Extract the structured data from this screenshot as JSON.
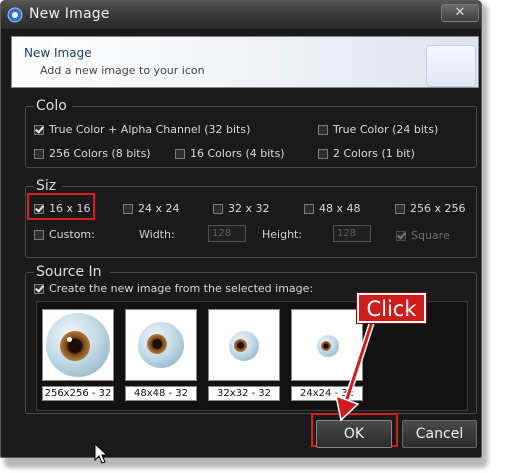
{
  "window": {
    "title": "New Image",
    "close_glyph": "✕"
  },
  "header": {
    "title": "New Image",
    "subtitle": "Add a new image to your icon"
  },
  "color_group": {
    "title": "Colo",
    "options": [
      {
        "label": "True Color + Alpha Channel (32 bits)",
        "checked": true
      },
      {
        "label": "True Color (24 bits)",
        "checked": false
      },
      {
        "label": "256 Colors (8 bits)",
        "checked": false
      },
      {
        "label": "16 Colors (4 bits)",
        "checked": false
      },
      {
        "label": "2 Colors (1 bit)",
        "checked": false
      }
    ]
  },
  "size_group": {
    "title": "Siz",
    "sizes": [
      {
        "label": "16 x 16",
        "checked": true
      },
      {
        "label": "24 x 24",
        "checked": false
      },
      {
        "label": "32 x 32",
        "checked": false
      },
      {
        "label": "48 x 48",
        "checked": false
      },
      {
        "label": "256 x 256",
        "checked": false
      }
    ],
    "custom_label": "Custom:",
    "width_label": "Width:",
    "width_value": "128",
    "height_label": "Height:",
    "height_value": "128",
    "square_label": "Square",
    "square_checked": true
  },
  "source_group": {
    "title": "Source In",
    "create_from_selected_label": "Create the new image from the selected image:",
    "create_from_selected_checked": true,
    "images": [
      {
        "caption": "256x256 - 32"
      },
      {
        "caption": "48x48 - 32"
      },
      {
        "caption": "32x32 - 32"
      },
      {
        "caption": "24x24 - 32"
      }
    ]
  },
  "buttons": {
    "ok": "OK",
    "cancel": "Cancel"
  },
  "annotation": {
    "callout": "Click"
  },
  "colors": {
    "window_bg": "#1a1a1a",
    "highlight_red": "#d42020",
    "callout_red": "#d01c1c",
    "header_title": "#1f3a66",
    "iris_brown": "#7a4a1e",
    "sclera_blue": "#b8d4e4"
  },
  "icons": {
    "app": "app-icon",
    "close": "close-icon",
    "checkbox": "checkbox",
    "cursor": "mouse-pointer-icon",
    "arrow": "annotation-arrow"
  }
}
